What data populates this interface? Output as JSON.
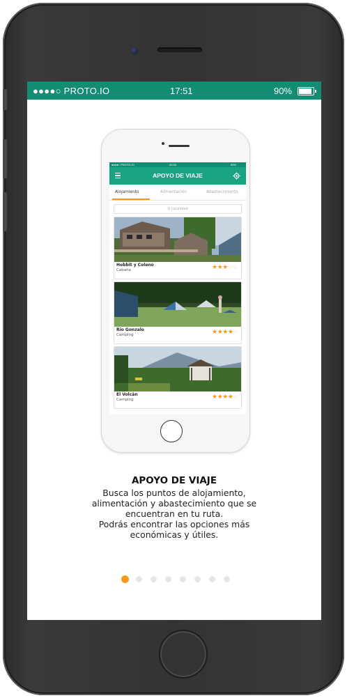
{
  "status_bar": {
    "carrier": "●●●●○ PROTO.IO",
    "time": "17:51",
    "battery": "90%",
    "battery_level": 0.9
  },
  "mock_app": {
    "status_left": "●●●●○ PROTO.IO",
    "status_time": "00:00",
    "status_right": "90%",
    "title": "APOYO DE VIAJE",
    "tabs": [
      {
        "label": "Alojamiento",
        "active": true
      },
      {
        "label": "Alimentación",
        "active": false
      },
      {
        "label": "Abastecimiento",
        "active": false
      }
    ],
    "search_placeholder": "Q Localidad",
    "listings": [
      {
        "name": "Hobbit y Coleno",
        "type": "Cabaña",
        "rating": 3,
        "max": 5
      },
      {
        "name": "Rio Gonzalo",
        "type": "Camping",
        "rating": 4,
        "max": 5
      },
      {
        "name": "El Volcán",
        "type": "Camping",
        "rating": 4,
        "max": 5
      }
    ]
  },
  "onboarding": {
    "title": "APOYO DE VIAJE",
    "lines": [
      "Busca los puntos de alojamiento,",
      "alimentación y abastecimiento que se",
      "encuentran en tu ruta.",
      "Podrás encontrar las opciones más",
      "económicas y útiles."
    ]
  },
  "pager": {
    "count": 8,
    "active_index": 0
  },
  "colors": {
    "status_green": "#128c72",
    "appbar_green": "#18a383",
    "accent_orange": "#f39a1e"
  }
}
